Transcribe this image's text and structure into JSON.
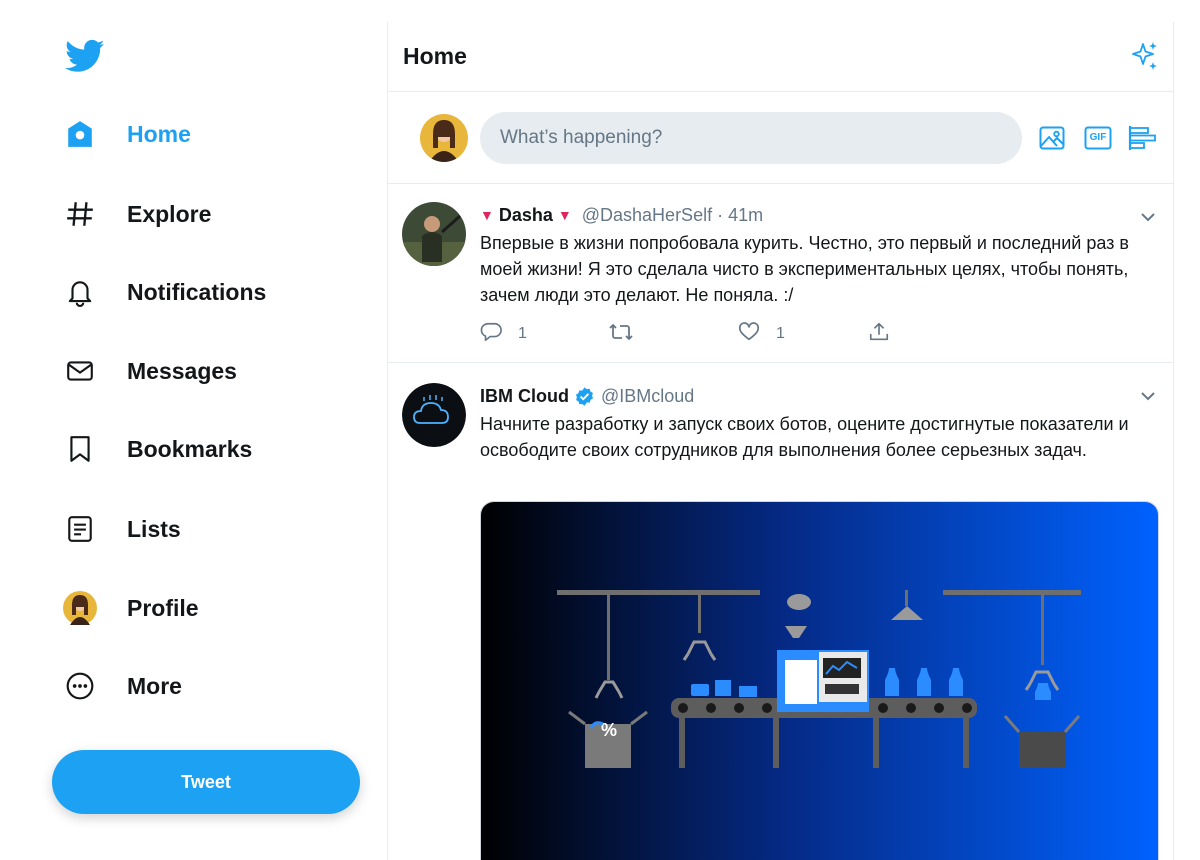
{
  "nav": {
    "items": [
      {
        "label": "Home",
        "icon": "home-icon",
        "active": true
      },
      {
        "label": "Explore",
        "icon": "hashtag-icon",
        "active": false
      },
      {
        "label": "Notifications",
        "icon": "bell-icon",
        "active": false
      },
      {
        "label": "Messages",
        "icon": "envelope-icon",
        "active": false
      },
      {
        "label": "Bookmarks",
        "icon": "bookmark-icon",
        "active": false
      },
      {
        "label": "Lists",
        "icon": "list-icon",
        "active": false
      },
      {
        "label": "Profile",
        "icon": "avatar",
        "active": false
      },
      {
        "label": "More",
        "icon": "more-icon",
        "active": false
      }
    ],
    "tweet_button": "Tweet"
  },
  "header": {
    "title": "Home"
  },
  "composer": {
    "placeholder": "What’s happening?",
    "gif_label": "GIF"
  },
  "tweets": [
    {
      "display_name": "Dasha",
      "handle": "@DashaHerSelf",
      "separator": "·",
      "time": "41m",
      "text": "Впервые в жизни попробовала курить. Честно, это первый и последний раз в моей жизни! Я это сделала чисто в экспериментальных целях, чтобы понять, зачем люди это делают. Не поняла. :/",
      "reply_count": "1",
      "like_count": "1",
      "name_marker": "▼"
    },
    {
      "display_name": "IBM Cloud",
      "handle": "@IBMcloud",
      "verified": true,
      "text": "Начните разработку и запуск своих ботов, оцените достигнутые показатели и освободите своих сотрудников для выполнения более серьезных задач.",
      "media_text": "%"
    }
  ],
  "colors": {
    "accent": "#1da1f2",
    "text": "#14171a",
    "muted": "#657786",
    "border": "#e6ecf0",
    "like_marker": "#e0245e"
  }
}
